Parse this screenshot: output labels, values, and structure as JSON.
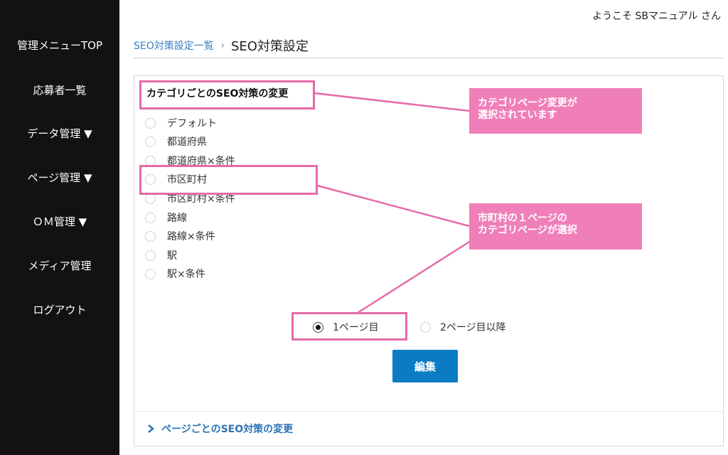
{
  "sidebar": {
    "items": [
      {
        "label": "管理メニューTOP"
      },
      {
        "label": "応募者一覧"
      },
      {
        "label": "データ管理 ▼"
      },
      {
        "label": "ページ管理 ▼"
      },
      {
        "label": "ＯＭ管理 ▼"
      },
      {
        "label": "メディア管理"
      },
      {
        "label": "ログアウト"
      }
    ]
  },
  "header": {
    "welcome": "ようこそ SBマニュアル さん"
  },
  "breadcrumb": {
    "parent": "SEO対策設定一覧",
    "separator": "›",
    "current": "SEO対策設定"
  },
  "category_section": {
    "title": "カテゴリごとのSEO対策の変更",
    "options": [
      {
        "label": "デフォルト"
      },
      {
        "label": "都道府県"
      },
      {
        "label": "都道府県×条件"
      },
      {
        "label": "市区町村"
      },
      {
        "label": "市区町村×条件"
      },
      {
        "label": "路線"
      },
      {
        "label": "路線×条件"
      },
      {
        "label": "駅"
      },
      {
        "label": "駅×条件"
      }
    ]
  },
  "page_options": {
    "first": {
      "label": "1ページ目",
      "selected": true
    },
    "rest": {
      "label": "2ページ目以降",
      "selected": false
    }
  },
  "edit_button": {
    "label": "編集"
  },
  "page_seo_link": {
    "label": "ページごとのSEO対策の変更"
  },
  "annotations": {
    "callout1": {
      "line1": "カテゴリページ変更が",
      "line2": "選択されています"
    },
    "callout2": {
      "line1": "市町村の１ページの",
      "line2": "カテゴリページが選択"
    }
  },
  "colors": {
    "sidebar_bg": "#121212",
    "accent_blue": "#0b7cc3",
    "link_blue": "#3a7fc1",
    "annotation_pink": "#f07fb9",
    "annotation_border": "#e66aa8"
  }
}
